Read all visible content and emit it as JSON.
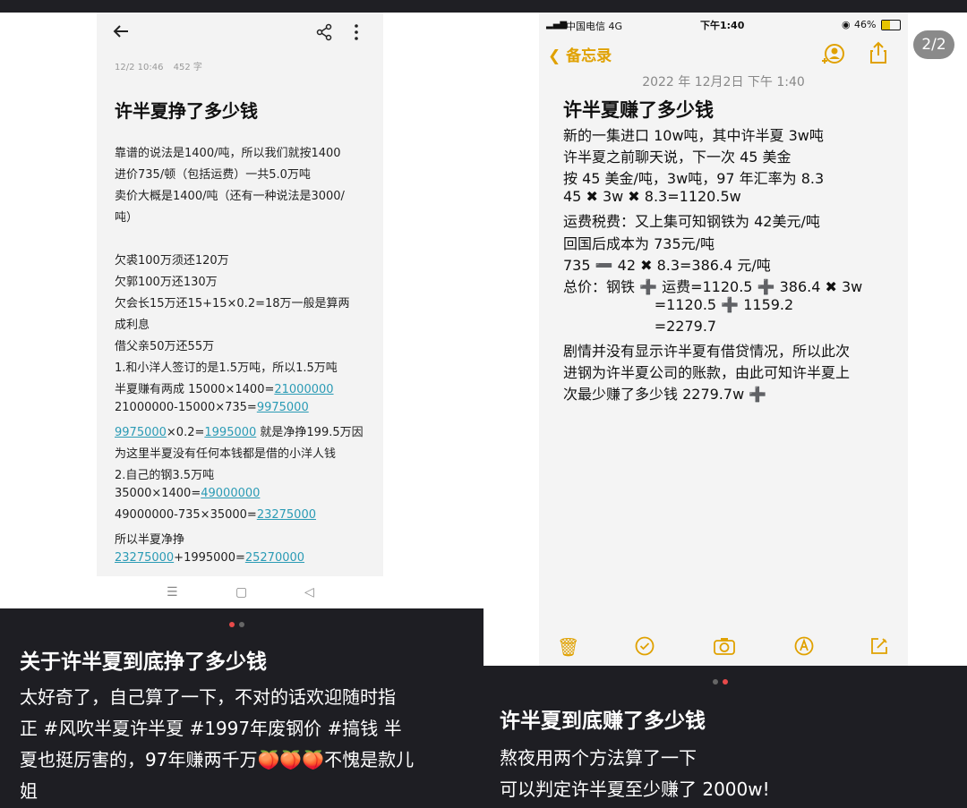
{
  "left": {
    "note": {
      "meta_date": "12/2 10:46",
      "meta_count": "452 字",
      "title": "许半夏挣了多少钱",
      "lines": [
        {
          "parts": [
            {
              "t": "靠谱的说法是1400/吨，所以我们就按1400"
            }
          ]
        },
        {
          "parts": [
            {
              "t": "进价735/顿（包括运费）一共5.0万吨"
            }
          ]
        },
        {
          "parts": [
            {
              "t": "卖价大概是1400/吨（还有一种说法是3000/"
            }
          ]
        },
        {
          "parts": [
            {
              "t": "吨）"
            }
          ]
        },
        {
          "parts": [
            {
              "t": ""
            }
          ]
        },
        {
          "parts": [
            {
              "t": "欠裘100万须还120万"
            }
          ]
        },
        {
          "parts": [
            {
              "t": "欠郭100万还130万"
            }
          ]
        },
        {
          "parts": [
            {
              "t": "欠会长15万还15+15×0.2=18万一般是算两"
            }
          ]
        },
        {
          "parts": [
            {
              "t": "成利息"
            }
          ]
        },
        {
          "parts": [
            {
              "t": "借父亲50万还55万"
            }
          ]
        },
        {
          "parts": [
            {
              "t": "1.和小洋人签订的是1.5万吨，所以1.5万吨"
            }
          ]
        },
        {
          "parts": [
            {
              "t": "半夏赚有两成  15000×1400="
            },
            {
              "t": "21000000",
              "link": true
            }
          ]
        },
        {
          "parts": [
            {
              "t": "21000000-15000×735="
            },
            {
              "t": "9975000",
              "link": true
            }
          ]
        },
        {
          "parts": [
            {
              "t": "9975000",
              "link": true
            },
            {
              "t": "×0.2="
            },
            {
              "t": "1995000",
              "link": true
            },
            {
              "t": " 就是净挣199.5万因"
            }
          ]
        },
        {
          "parts": [
            {
              "t": "为这里半夏没有任何本钱都是借的小洋人钱"
            }
          ]
        },
        {
          "parts": [
            {
              "t": "2.自己的钢3.5万吨"
            }
          ]
        },
        {
          "parts": [
            {
              "t": "35000×1400="
            },
            {
              "t": "49000000",
              "link": true
            }
          ]
        },
        {
          "parts": [
            {
              "t": "49000000-735×35000="
            },
            {
              "t": "23275000",
              "link": true
            }
          ]
        },
        {
          "parts": [
            {
              "t": "所以半夏净挣"
            }
          ]
        },
        {
          "parts": [
            {
              "t": "23275000",
              "link": true
            },
            {
              "t": "+1995000="
            },
            {
              "t": "25270000",
              "link": true
            }
          ]
        }
      ]
    },
    "caption": {
      "title": "关于许半夏到底挣了多少钱",
      "body_lines": [
        "太好奇了，自己算了一下，不对的话欢迎随时指",
        "正 #风吹半夏许半夏  #1997年废钢价  #搞钱 半",
        "夏也挺厉害的，97年赚两千万🍑🍑🍑不愧是款儿",
        "姐"
      ]
    }
  },
  "right": {
    "status": {
      "carrier": "中国电信  4G",
      "time": "下午1:40",
      "battery": "46%"
    },
    "back_label": "备忘录",
    "page_badge": "2/2",
    "note": {
      "date": "2022 年 12月2日  下午 1:40",
      "title": "许半夏赚了多少钱",
      "lines": [
        "新的一集进口 10w吨，其中许半夏 3w吨",
        "许半夏之前聊天说，下一次 45 美金",
        "按 45 美金/吨，3w吨，97 年汇率为 8.3",
        "45 ✖ 3w ✖ 8.3=1120.5w",
        "运费税费：又上集可知钢铁为 42美元/吨",
        "回国后成本为 735元/吨",
        "735 ➖ 42 ✖ 8.3=386.4 元/吨",
        "总价：钢铁 ➕ 运费=1120.5 ➕ 386.4 ✖ 3w",
        "                    =1120.5 ➕ 1159.2",
        "                    =2279.7",
        "剧情并没有显示许半夏有借贷情况，所以此次",
        "进钢为许半夏公司的账款，由此可知许半夏上",
        "次最少赚了多少钱 2279.7w ➕"
      ]
    },
    "caption": {
      "title": "许半夏到底赚了多少钱",
      "body_lines": [
        "熬夜用两个方法算了一下",
        "可以判定许半夏至少赚了 2000w!"
      ]
    }
  },
  "colors": {
    "accent_yellow": "#e0a100",
    "link": "#2b9bb5",
    "dot_active": "#e84a4a"
  }
}
